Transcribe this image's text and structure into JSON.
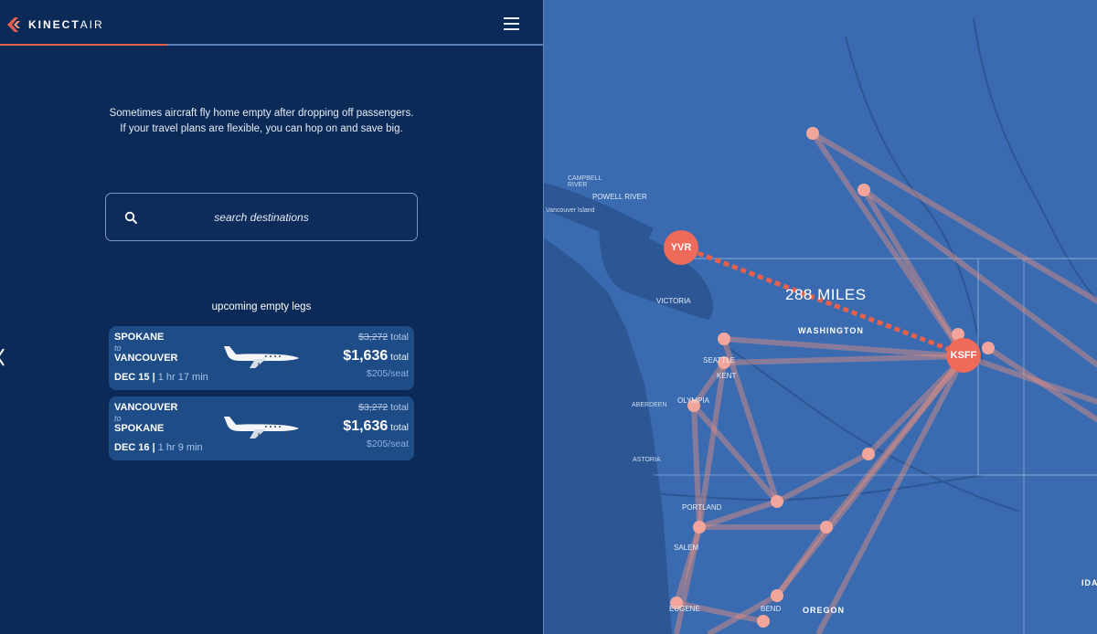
{
  "header": {
    "logo_bold": "KINECT",
    "logo_light": "AIR",
    "menu_icon": "hamburger-menu-icon"
  },
  "intro": {
    "line1": "Sometimes aircraft fly home empty after dropping off passengers.",
    "line2": "If your travel plans are flexible, you can hop on and save big."
  },
  "search": {
    "placeholder": "search destinations",
    "icon": "search-icon"
  },
  "legs": {
    "title": "upcoming empty legs",
    "items": [
      {
        "from": "SPOKANE",
        "to_word": "to",
        "to": "VANCOUVER",
        "date": "DEC 15",
        "duration": "1 hr 17 min",
        "original_price": "$3,272",
        "original_suffix": " total",
        "price": "$1,636",
        "price_suffix": " total",
        "per_seat": "$205/seat"
      },
      {
        "from": "VANCOUVER",
        "to_word": "to",
        "to": "SPOKANE",
        "date": "DEC 16",
        "duration": "1 hr 9 min",
        "original_price": "$3,272",
        "original_suffix": " total",
        "price": "$1,636",
        "price_suffix": " total",
        "per_seat": "$205/seat"
      }
    ]
  },
  "map": {
    "distance": "288 MILES",
    "airports": {
      "origin": "YVR",
      "destination": "KSFF"
    },
    "labels": {
      "campbell_river": "CAMPBELL\nRIVER",
      "powell_river": "POWELL RIVER",
      "vancouver_island": "Vancouver Island",
      "victoria": "VICTORIA",
      "washington": "WASHINGTON",
      "seattle": "SEATTLE",
      "kent": "KENT",
      "olympia": "OLYMPIA",
      "aberdeen": "ABERDEEN",
      "astoria": "ASTORIA",
      "portland": "PORTLAND",
      "salem": "SALEM",
      "eugene": "EUGENE",
      "bend": "BEND",
      "oregon": "OREGON",
      "idaho": "IDA"
    },
    "colors": {
      "water": "#2f5a98",
      "land": "#3a6bb0",
      "route": "#e8604c",
      "node": "#f2a59a"
    }
  }
}
